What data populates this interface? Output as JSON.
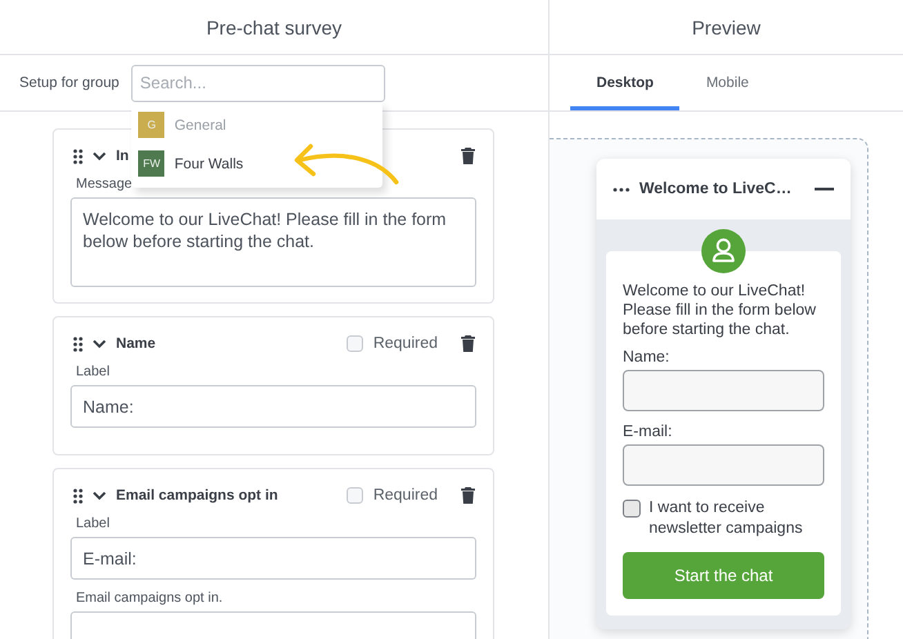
{
  "editor": {
    "title": "Pre-chat survey",
    "group_label": "Setup for group",
    "search": {
      "placeholder": "Search..."
    },
    "groups": [
      {
        "initials": "G",
        "label": "General",
        "color": "#c9ad4f",
        "disabled": true
      },
      {
        "initials": "FW",
        "label": "Four Walls",
        "color": "#4f7a4f",
        "disabled": false
      }
    ],
    "cards": [
      {
        "kind": "message",
        "title": "In",
        "fields": [
          {
            "label": "Message",
            "value": "Welcome to our LiveChat! Please fill in the form below before starting the chat.",
            "multiline": true
          }
        ]
      },
      {
        "kind": "question",
        "title": "Name",
        "required_label": "Required",
        "required": false,
        "fields": [
          {
            "label": "Label",
            "value": "Name:",
            "multiline": false
          }
        ]
      },
      {
        "kind": "question",
        "title": "Email campaigns opt in",
        "required_label": "Required",
        "required": false,
        "fields": [
          {
            "label": "Label",
            "value": "E-mail:",
            "multiline": false
          },
          {
            "label": "Email campaigns opt in.",
            "multiline": false
          }
        ]
      }
    ]
  },
  "preview": {
    "title": "Preview",
    "tabs": [
      {
        "label": "Desktop",
        "selected": true
      },
      {
        "label": "Mobile",
        "selected": false
      }
    ],
    "chat": {
      "title": "Welcome to LiveC…",
      "message": "Welcome to our LiveChat! Please fill in the form below before starting the chat.",
      "fields": [
        {
          "label": "Name:"
        },
        {
          "label": "E-mail:"
        }
      ],
      "opt_in": {
        "label": "I want to receive newsletter campaigns",
        "checked": false
      },
      "button": "Start the chat"
    }
  }
}
